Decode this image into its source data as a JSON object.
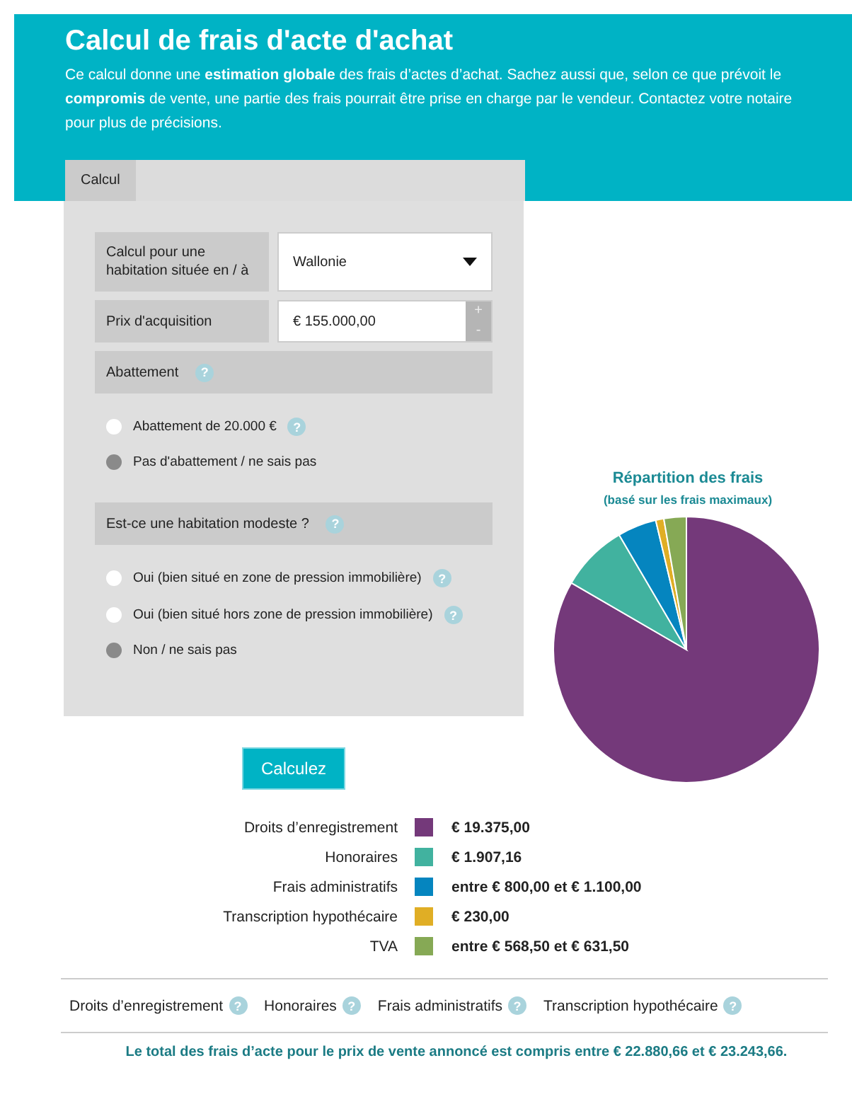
{
  "header": {
    "title": "Calcul de frais d'acte d'achat",
    "intro": "Ce calcul donne une **estimation globale** des frais d’actes d’achat. Sachez aussi que, selon ce que prévoit le **compromis** de vente, une partie des frais pourrait être prise en charge par le vendeur. Contactez votre notaire pour plus de précisions.",
    "tabs": [
      {
        "label": "Calcul",
        "selected": true
      }
    ]
  },
  "form": {
    "location": {
      "label": "Calcul pour une habitation située en / à",
      "value": "Wallonie"
    },
    "price": {
      "label": "Prix d'acquisition",
      "value": "€ 155.000,00",
      "increment": "+",
      "decrement": "-"
    },
    "groups": [
      {
        "title": "Abattement",
        "help": "?",
        "options": [
          {
            "label": "Abattement de 20.000 €",
            "selected": false,
            "help": "?"
          },
          {
            "label": "Pas d'abattement / ne sais pas",
            "selected": true
          }
        ]
      },
      {
        "title": "Est-ce une habitation modeste ?",
        "help": "?",
        "options": [
          {
            "label": "Oui (bien situé en zone de pression immobilière)",
            "selected": false,
            "help": "?"
          },
          {
            "label": "Oui (bien situé hors zone de pression immobilière)",
            "selected": false,
            "help": "?"
          },
          {
            "label": "Non / ne sais pas",
            "selected": true
          }
        ]
      }
    ]
  },
  "button": "Calculez",
  "chart": {
    "subtitle": "(basé sur les frais maximaux)",
    "chart_data": {
      "type": "pie",
      "title": "Répartition des frais",
      "categories": [
        "Droits d’enregistrement",
        "Honoraires",
        "Frais administratifs",
        "Transcription hypothécaire",
        "TVA"
      ],
      "values": [
        83.36,
        8.2,
        4.73,
        0.99,
        2.72
      ]
    }
  },
  "legend": [
    {
      "color": "#74397a",
      "amount": "€ 19.375,00"
    },
    {
      "color": "#41b29f",
      "amount": "€ 1.907,16"
    },
    {
      "color": "#0585bf",
      "amount": "entre € 800,00 et € 1.100,00"
    },
    {
      "color": "#e0ae25",
      "amount": "€ 230,00"
    },
    {
      "color": "#86a955",
      "amount": "entre € 568,50 et € 631,50"
    }
  ],
  "info_links": [
    {
      "label": "Droits d’enregistrement",
      "help": "?"
    },
    {
      "label": "Honoraires",
      "help": "?"
    },
    {
      "label": "Frais administratifs",
      "help": "?"
    },
    {
      "label": "Transcription hypothécaire",
      "help": "?"
    }
  ],
  "total": "Le total des frais d’acte pour le prix de vente annoncé est compris entre € 22.880,66 et € 23.243,66."
}
